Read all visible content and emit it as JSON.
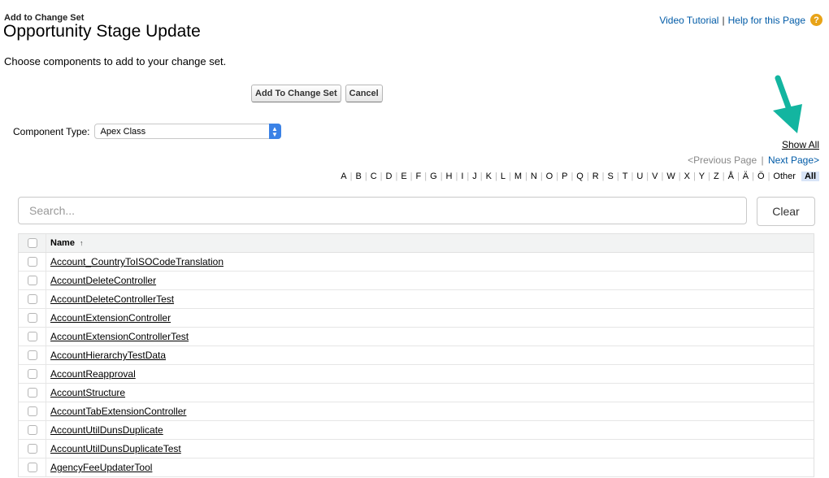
{
  "header": {
    "subtitle": "Add to Change Set",
    "title": "Opportunity Stage Update",
    "video_tutorial": "Video Tutorial",
    "separator": "|",
    "help_link": "Help for this Page",
    "help_icon_glyph": "?"
  },
  "instructions": "Choose components to add to your change set.",
  "buttons": {
    "add": "Add To Change Set",
    "cancel": "Cancel"
  },
  "component_type": {
    "label": "Component Type:",
    "selected": "Apex Class"
  },
  "paging": {
    "show_all": "Show All",
    "previous": "<Previous Page",
    "separator": "|",
    "next": "Next Page>"
  },
  "alphabet": [
    "A",
    "B",
    "C",
    "D",
    "E",
    "F",
    "G",
    "H",
    "I",
    "J",
    "K",
    "L",
    "M",
    "N",
    "O",
    "P",
    "Q",
    "R",
    "S",
    "T",
    "U",
    "V",
    "W",
    "X",
    "Y",
    "Z",
    "Å",
    "Ä",
    "Ö",
    "Other"
  ],
  "alphabet_all": "All",
  "search": {
    "placeholder": "Search...",
    "clear": "Clear"
  },
  "table": {
    "header_name": "Name",
    "sort_glyph": "↑",
    "rows": [
      "Account_CountryToISOCodeTranslation",
      "AccountDeleteController",
      "AccountDeleteControllerTest",
      "AccountExtensionController",
      "AccountExtensionControllerTest",
      "AccountHierarchyTestData",
      "AccountReapproval",
      "AccountStructure",
      "AccountTabExtensionController",
      "AccountUtilDunsDuplicate",
      "AccountUtilDunsDuplicateTest",
      "AgencyFeeUpdaterTool"
    ]
  },
  "colors": {
    "link": "#015ba7",
    "annotation_arrow": "#13b5a0",
    "help_icon": "#e8a317",
    "select_accent": "#3b82e6"
  },
  "icons": {
    "help": "question-circle-icon",
    "select": "chevron-up-down-icon",
    "arrow": "annotation-arrow-icon",
    "sort": "sort-ascending-icon"
  }
}
